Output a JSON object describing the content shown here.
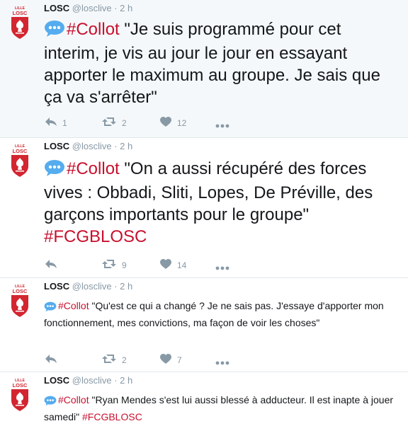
{
  "tweets": [
    {
      "name": "LOSC",
      "handle": "@losclive",
      "sep": "·",
      "time": "2 h",
      "hashtag": "#Collot",
      "body": " \"Je suis programmé pour cet interim, je vis au jour le jour en essayant apporter le maximum au groupe. Je sais que ça va s'arrêter\"",
      "tail_hashtag": "",
      "replies": "1",
      "retweets": "2",
      "likes": "12"
    },
    {
      "name": "LOSC",
      "handle": "@losclive",
      "sep": "·",
      "time": "2 h",
      "hashtag": "#Collot",
      "body": " \"On a aussi récupéré des forces vives : Obbadi, Sliti, Lopes, De Préville, des garçons importants pour le groupe\" ",
      "tail_hashtag": "#FCGBLOSC",
      "replies": "",
      "retweets": "9",
      "likes": "14"
    },
    {
      "name": "LOSC",
      "handle": "@losclive",
      "sep": "·",
      "time": "2 h",
      "hashtag": "#Collot",
      "body": " \"Qu'est ce qui a changé ? Je ne sais pas. J'essaye d'apporter mon fonctionnement, mes convictions, ma façon de voir les choses\"",
      "tail_hashtag": "",
      "replies": "",
      "retweets": "2",
      "likes": "7"
    },
    {
      "name": "LOSC",
      "handle": "@losclive",
      "sep": "·",
      "time": "2 h",
      "hashtag": "#Collot",
      "body": " \"Ryan Mendes s'est lui aussi blessé à adducteur. Il est inapte à jouer samedi\" ",
      "tail_hashtag": "#FCGBLOSC"
    }
  ],
  "logo_text": "LILLE LOSC",
  "icons": [
    "speech-bubble-icon",
    "reply-icon",
    "retweet-icon",
    "heart-icon",
    "more-icon"
  ],
  "colors": {
    "hashtag": "#c8102e",
    "meta": "#8899a6",
    "crest": "#d22630"
  }
}
